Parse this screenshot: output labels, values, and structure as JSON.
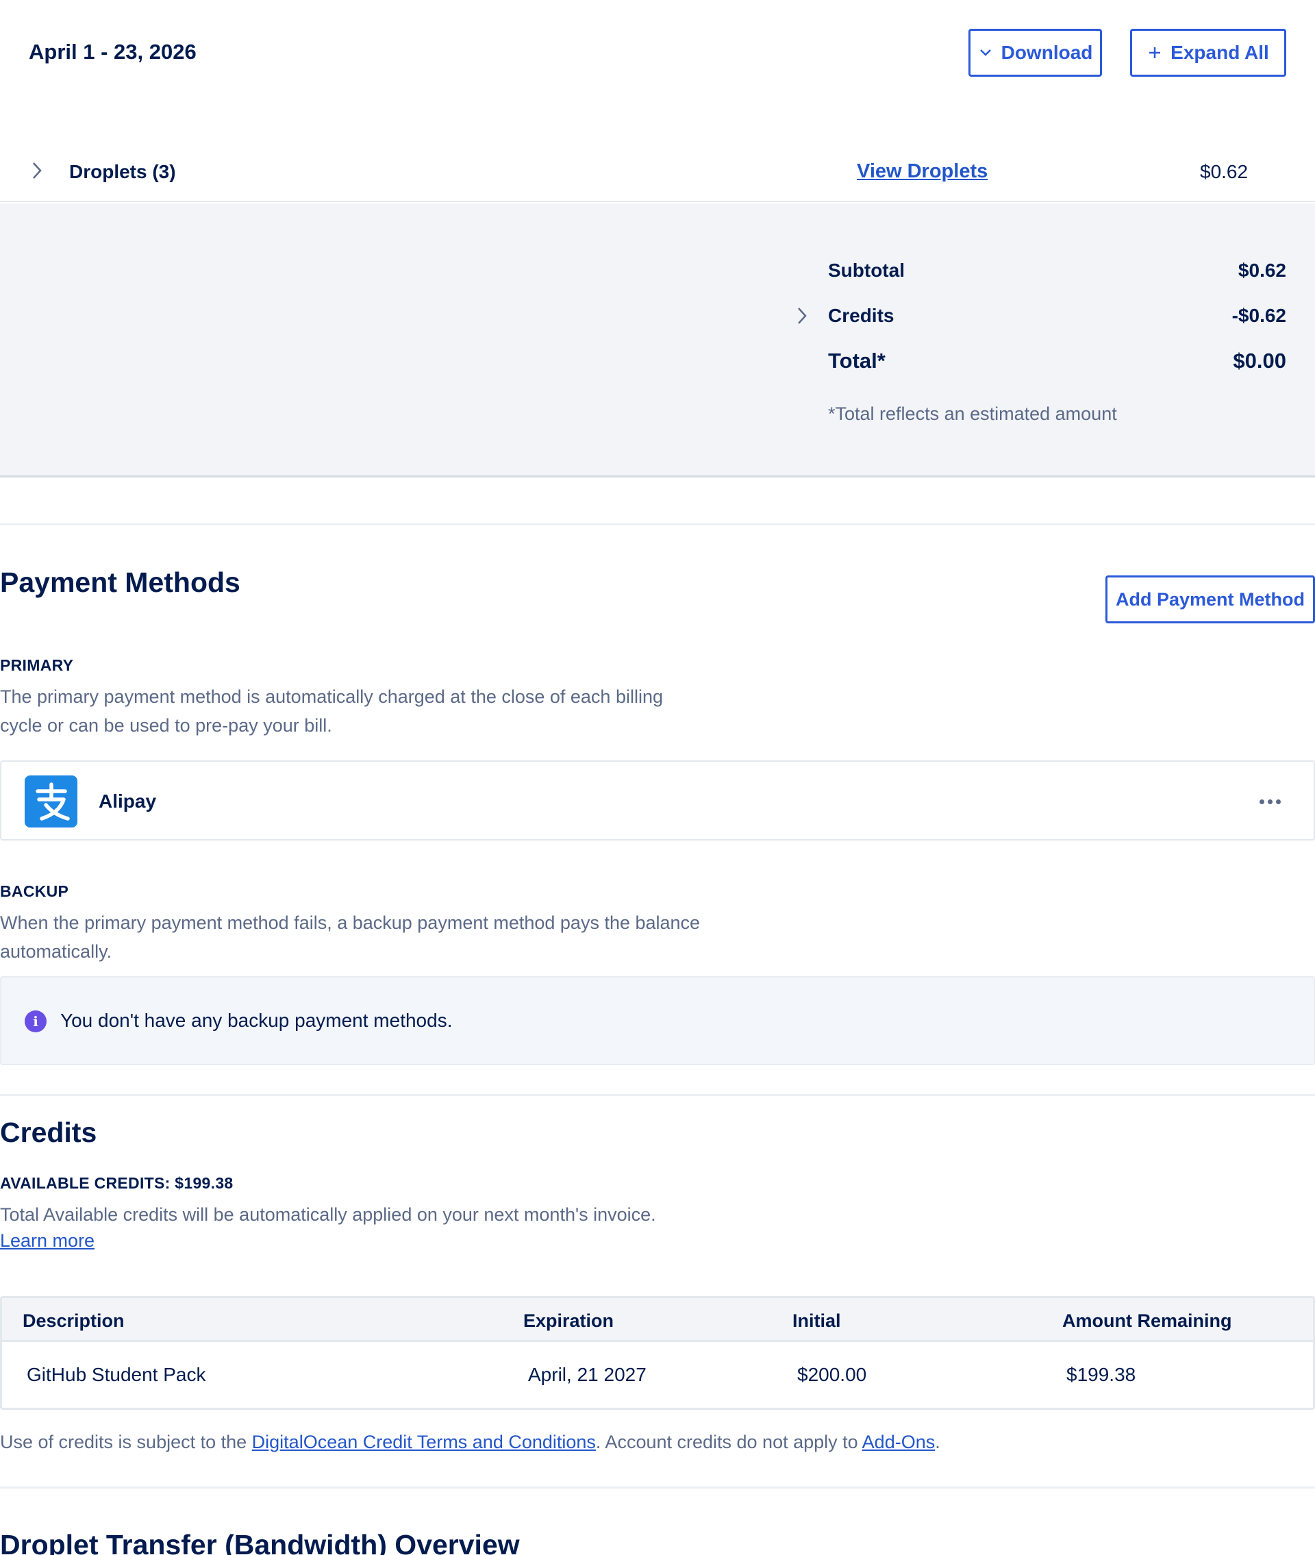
{
  "header": {
    "period": "April 1 - 23, 2026",
    "download_label": "Download",
    "expand_all_label": "Expand All"
  },
  "droplets_row": {
    "label": "Droplets (3)",
    "link_label": "View Droplets",
    "amount": "$0.62"
  },
  "summary": {
    "subtotal_label": "Subtotal",
    "subtotal_value": "$0.62",
    "credits_label": "Credits",
    "credits_value": "-$0.62",
    "total_label": "Total*",
    "total_value": "$0.00",
    "note": "*Total reflects an estimated amount"
  },
  "payment_methods": {
    "title": "Payment Methods",
    "add_button_label": "Add Payment Method",
    "primary_heading": "PRIMARY",
    "primary_help_line1": "The primary payment method is automatically charged at the close of each billing",
    "primary_help_line2": "cycle or can be used to pre-pay your bill.",
    "primary_method_name": "Alipay",
    "primary_method_icon": "alipay-logo-icon",
    "backup_heading": "BACKUP",
    "backup_help_line1": "When the primary payment method fails, a backup payment method pays the balance",
    "backup_help_line2": "automatically.",
    "backup_empty_message": "You don't have any backup payment methods."
  },
  "credits": {
    "title": "Credits",
    "available_label": "AVAILABLE CREDITS: $199.38",
    "help_text": "Total Available credits will be automatically applied on your next month's invoice.",
    "learn_more_label": "Learn more",
    "table": {
      "headers": [
        "Description",
        "Expiration",
        "Initial",
        "Amount Remaining"
      ],
      "rows": [
        [
          "GitHub Student Pack",
          "April, 21 2027",
          "$200.00",
          "$199.38"
        ]
      ]
    },
    "terms_prefix": "Use of credits is subject to the ",
    "terms_link": "DigitalOcean Credit Terms and Conditions",
    "terms_middle": ". Account credits do not apply to ",
    "addons_link": "Add-Ons",
    "terms_suffix": "."
  },
  "bandwidth": {
    "title": "Droplet Transfer (Bandwidth) Overview"
  },
  "colors": {
    "primary_blue": "#2b59d9",
    "text_dark": "#031b4e",
    "text_muted": "#5b6987",
    "panel_bg": "#f2f4f7",
    "info_purple": "#6a4fe6",
    "alipay_blue": "#1e88e5"
  }
}
